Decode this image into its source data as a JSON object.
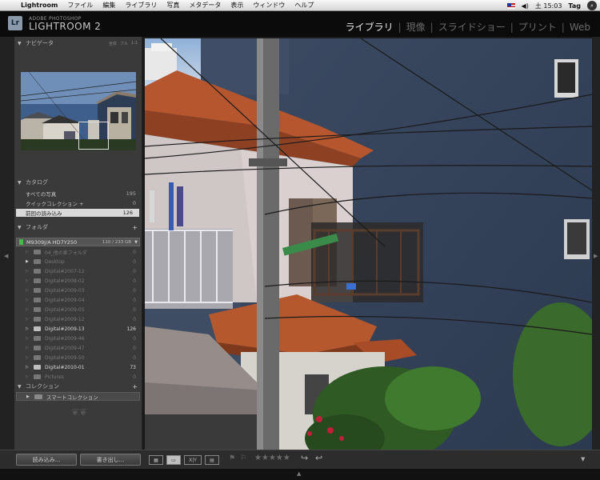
{
  "menubar": {
    "app_name": "Lightroom",
    "menus": [
      "ファイル",
      "編集",
      "ライブラリ",
      "写真",
      "メタデータ",
      "表示",
      "ウィンドウ",
      "ヘルプ"
    ],
    "clock": "土 15:03",
    "tag_label": "Tag"
  },
  "identity": {
    "badge": "Lr",
    "line1": "ADOBE PHOTOSHOP",
    "line2": "LIGHTROOM 2"
  },
  "modules": [
    {
      "label": "ライブラリ",
      "active": true
    },
    {
      "label": "現像",
      "active": false
    },
    {
      "label": "スライドショー",
      "active": false
    },
    {
      "label": "プリント",
      "active": false
    },
    {
      "label": "Web",
      "active": false
    }
  ],
  "navigator": {
    "title": "ナビゲータ",
    "options": [
      "全体",
      "フル",
      "1:1"
    ]
  },
  "catalog": {
    "title": "カタログ",
    "items": [
      {
        "label": "すべての写真",
        "count": "195",
        "selected": false
      },
      {
        "label": "クイックコレクション +",
        "count": "0",
        "selected": false
      },
      {
        "label": "前回の読み込み",
        "count": "126",
        "selected": true
      }
    ]
  },
  "folders": {
    "title": "フォルダ",
    "volume": {
      "name": "M9309J/A HD7Y250",
      "usage": "110 / 233 GB"
    },
    "items": [
      {
        "label": "04_他の家フォルダ",
        "count": "0",
        "expanded": false,
        "bright": false
      },
      {
        "label": "Desktop",
        "count": "0",
        "expanded": true,
        "bright": false
      },
      {
        "label": "Digital#2007-12",
        "count": "0",
        "expanded": false,
        "bright": false
      },
      {
        "label": "Digital#2008-02",
        "count": "0",
        "expanded": false,
        "bright": false
      },
      {
        "label": "Digital#2009-03",
        "count": "0",
        "expanded": false,
        "bright": false
      },
      {
        "label": "Digital#2009-04",
        "count": "0",
        "expanded": false,
        "bright": false
      },
      {
        "label": "Digital#2009-05",
        "count": "0",
        "expanded": false,
        "bright": false
      },
      {
        "label": "Digital#2009-12",
        "count": "0",
        "expanded": false,
        "bright": false
      },
      {
        "label": "Digital#2009-13",
        "count": "126",
        "expanded": false,
        "bright": true
      },
      {
        "label": "Digital#2009-46",
        "count": "0",
        "expanded": false,
        "bright": false
      },
      {
        "label": "Digital#2009-47",
        "count": "0",
        "expanded": false,
        "bright": false
      },
      {
        "label": "Digital#2009-50",
        "count": "0",
        "expanded": false,
        "bright": false
      },
      {
        "label": "Digital#2010-01",
        "count": "73",
        "expanded": false,
        "bright": true
      },
      {
        "label": "Pictures",
        "count": "0",
        "expanded": false,
        "bright": false
      }
    ]
  },
  "collections": {
    "title": "コレクション",
    "items": [
      {
        "label": "スマートコレクション"
      }
    ]
  },
  "buttons": {
    "import": "読み込み...",
    "export": "書き出し..."
  },
  "toolbar": {
    "compare_label": "X|Y",
    "rating_stars": 5
  },
  "colors": {
    "panel_bg": "#3a3a3a",
    "selected_row": "#d9d9d9",
    "active_module": "#e8e8e8",
    "inactive_module": "#6a6a6a"
  }
}
